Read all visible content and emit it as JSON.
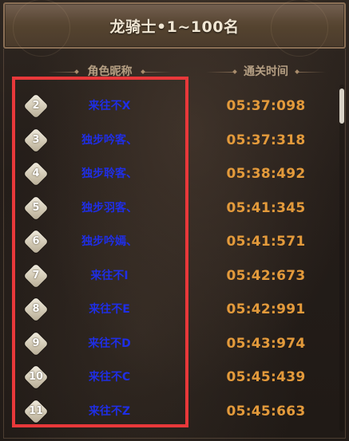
{
  "title": "龙骑士•1~100名",
  "columns": {
    "name_header": "角色昵称",
    "time_header": "通关时间"
  },
  "rows": [
    {
      "rank": "2",
      "name": "来往不X",
      "time": "05:37:098"
    },
    {
      "rank": "3",
      "name": "独步吟客、",
      "time": "05:37:318"
    },
    {
      "rank": "4",
      "name": "独步聆客、",
      "time": "05:38:492"
    },
    {
      "rank": "5",
      "name": "独步羽客、",
      "time": "05:41:345"
    },
    {
      "rank": "6",
      "name": "独步吟嫣、",
      "time": "05:41:571"
    },
    {
      "rank": "7",
      "name": "来往不I",
      "time": "05:42:673"
    },
    {
      "rank": "8",
      "name": "来往不E",
      "time": "05:42:991"
    },
    {
      "rank": "9",
      "name": "来往不D",
      "time": "05:43:974"
    },
    {
      "rank": "10",
      "name": "来往不C",
      "time": "05:45:439"
    },
    {
      "rank": "11",
      "name": "来往不Z",
      "time": "05:45:663"
    }
  ],
  "colors": {
    "name_text": "#1f2ee6",
    "time_text": "#e39a3b",
    "highlight_border": "#e8383a",
    "title_text": "#f1e7d4"
  },
  "icons": {
    "rank_badge": "diamond-badge-icon"
  }
}
